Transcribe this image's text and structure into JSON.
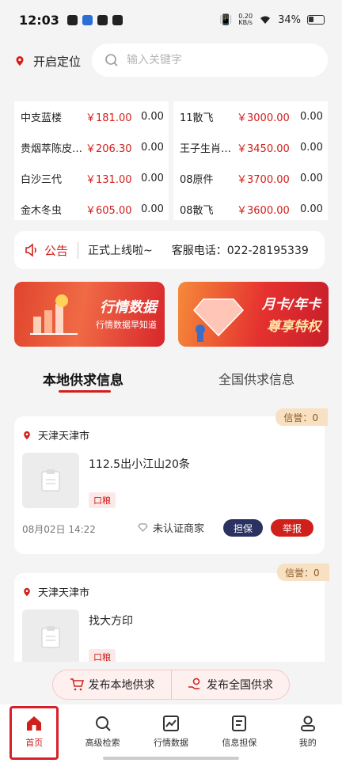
{
  "status_bar": {
    "time": "12:03",
    "net_speed_value": "0.20",
    "net_speed_unit": "KB/s",
    "battery": "34%"
  },
  "location": {
    "label": "开启定位"
  },
  "search": {
    "placeholder": "输入关键字"
  },
  "prices": {
    "left": [
      {
        "name": "中支蓝楼",
        "price": "￥181.00",
        "change": "0.00"
      },
      {
        "name": "贵烟萃陈皮…",
        "price": "￥206.30",
        "change": "0.00"
      },
      {
        "name": "白沙三代",
        "price": "￥131.00",
        "change": "0.00"
      },
      {
        "name": "金木冬虫",
        "price": "￥605.00",
        "change": "0.00"
      }
    ],
    "right": [
      {
        "name": "11散飞",
        "price": "￥3000.00",
        "change": "0.00"
      },
      {
        "name": "王子生肖…",
        "price": "￥3450.00",
        "change": "0.00"
      },
      {
        "name": "08原件",
        "price": "￥3700.00",
        "change": "0.00"
      },
      {
        "name": "08散飞",
        "price": "￥3600.00",
        "change": "0.00"
      }
    ]
  },
  "notice": {
    "label": "公告",
    "text": "正式上线啦~",
    "phone": "客服电话：022-28195339"
  },
  "banners": [
    {
      "title": "行情数据",
      "subtitle": "行情数据早知道"
    },
    {
      "title": "月卡/年卡",
      "subtitle": "尊享特权"
    }
  ],
  "tabs": {
    "local": "本地供求信息",
    "national": "全国供求信息"
  },
  "cards": [
    {
      "credit": "信誉：0",
      "location": "天津天津市",
      "title": "112.5出小江山20条",
      "tag": "口粮",
      "date": "08月02日 14:22",
      "merchant": "未认证商家",
      "guarantee": "担保",
      "report": "举报"
    },
    {
      "credit": "信誉：0",
      "location": "天津天津市",
      "title": "找大方印",
      "tag": "口粮"
    }
  ],
  "publish": {
    "local": "发布本地供求",
    "national": "发布全国供求"
  },
  "nav": [
    {
      "label": "首页",
      "icon": "home-icon"
    },
    {
      "label": "高级检索",
      "icon": "search-icon"
    },
    {
      "label": "行情数据",
      "icon": "chart-icon"
    },
    {
      "label": "信息担保",
      "icon": "document-icon"
    },
    {
      "label": "我的",
      "icon": "user-icon"
    }
  ],
  "colors": {
    "accent": "#d0201c",
    "navy": "#2b3160",
    "credit_bg": "#f8e0c2"
  }
}
